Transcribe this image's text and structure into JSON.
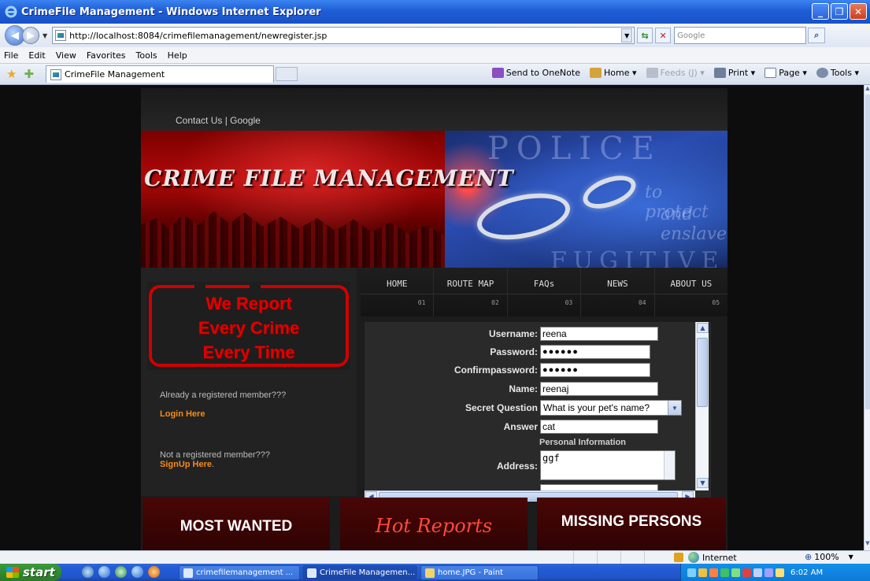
{
  "window": {
    "title": "CrimeFile Management - Windows Internet Explorer",
    "minimize": "_",
    "maximize": "❐",
    "close": "✕"
  },
  "address": {
    "url": "http://localhost:8084/crimefilemanagement/newregister.jsp",
    "search_placeholder": "Google"
  },
  "menu": [
    "File",
    "Edit",
    "View",
    "Favorites",
    "Tools",
    "Help"
  ],
  "tab": {
    "label": "CrimeFile Management"
  },
  "command_bar": {
    "onenote": "Send to OneNote",
    "home": "Home",
    "feeds": "Feeds (J)",
    "print": "Print",
    "page": "Page",
    "tools": "Tools"
  },
  "site": {
    "top_links": "Contact Us | Google",
    "banner_title": "CRIME FILE MANAGEMENT",
    "banner_words": {
      "police": "POLICE",
      "fugitive": "FUGITIVE",
      "protect": "to protect",
      "enslave": "and enslave"
    },
    "report_lines": [
      "We Report",
      "Every Crime",
      "Every Time"
    ],
    "already_member": "Already a registered member???",
    "login_link": "Login Here",
    "not_member": "Not a registered member???",
    "signup_link": "SignUp Here",
    "signup_period": ".",
    "nav": [
      {
        "label": "HOME",
        "num": "01"
      },
      {
        "label": "ROUTE MAP",
        "num": "02"
      },
      {
        "label": "FAQs",
        "num": "03"
      },
      {
        "label": "NEWS",
        "num": "04"
      },
      {
        "label": "ABOUT US",
        "num": "05"
      }
    ],
    "form": {
      "username_label": "Username:",
      "username_value": "reena",
      "password_label": "Password:",
      "password_value": "●●●●●●",
      "confirm_label": "Confirmpassword:",
      "confirm_value": "●●●●●●",
      "name_label": "Name:",
      "name_value": "reenaj",
      "secret_label": "Secret Question",
      "secret_value": "What is your pet's name?",
      "answer_label": "Answer",
      "answer_value": "cat",
      "personal_header": "Personal Information",
      "address_label": "Address:",
      "address_value": "ggf"
    },
    "boxes": {
      "most_wanted": "MOST WANTED",
      "hot_reports": "Hot Reports",
      "missing": "MISSING PERSONS"
    }
  },
  "status": {
    "zone": "Internet",
    "zoom": "100%"
  },
  "taskbar": {
    "start": "start",
    "items": [
      "crimefilemanagement ...",
      "CrimeFile Managemen...",
      "home.JPG - Paint"
    ],
    "clock": "6:02 AM"
  },
  "colors": {
    "xp_blue": "#245dd8",
    "accent_red": "#d00000",
    "link_orange": "#f58a1a"
  }
}
